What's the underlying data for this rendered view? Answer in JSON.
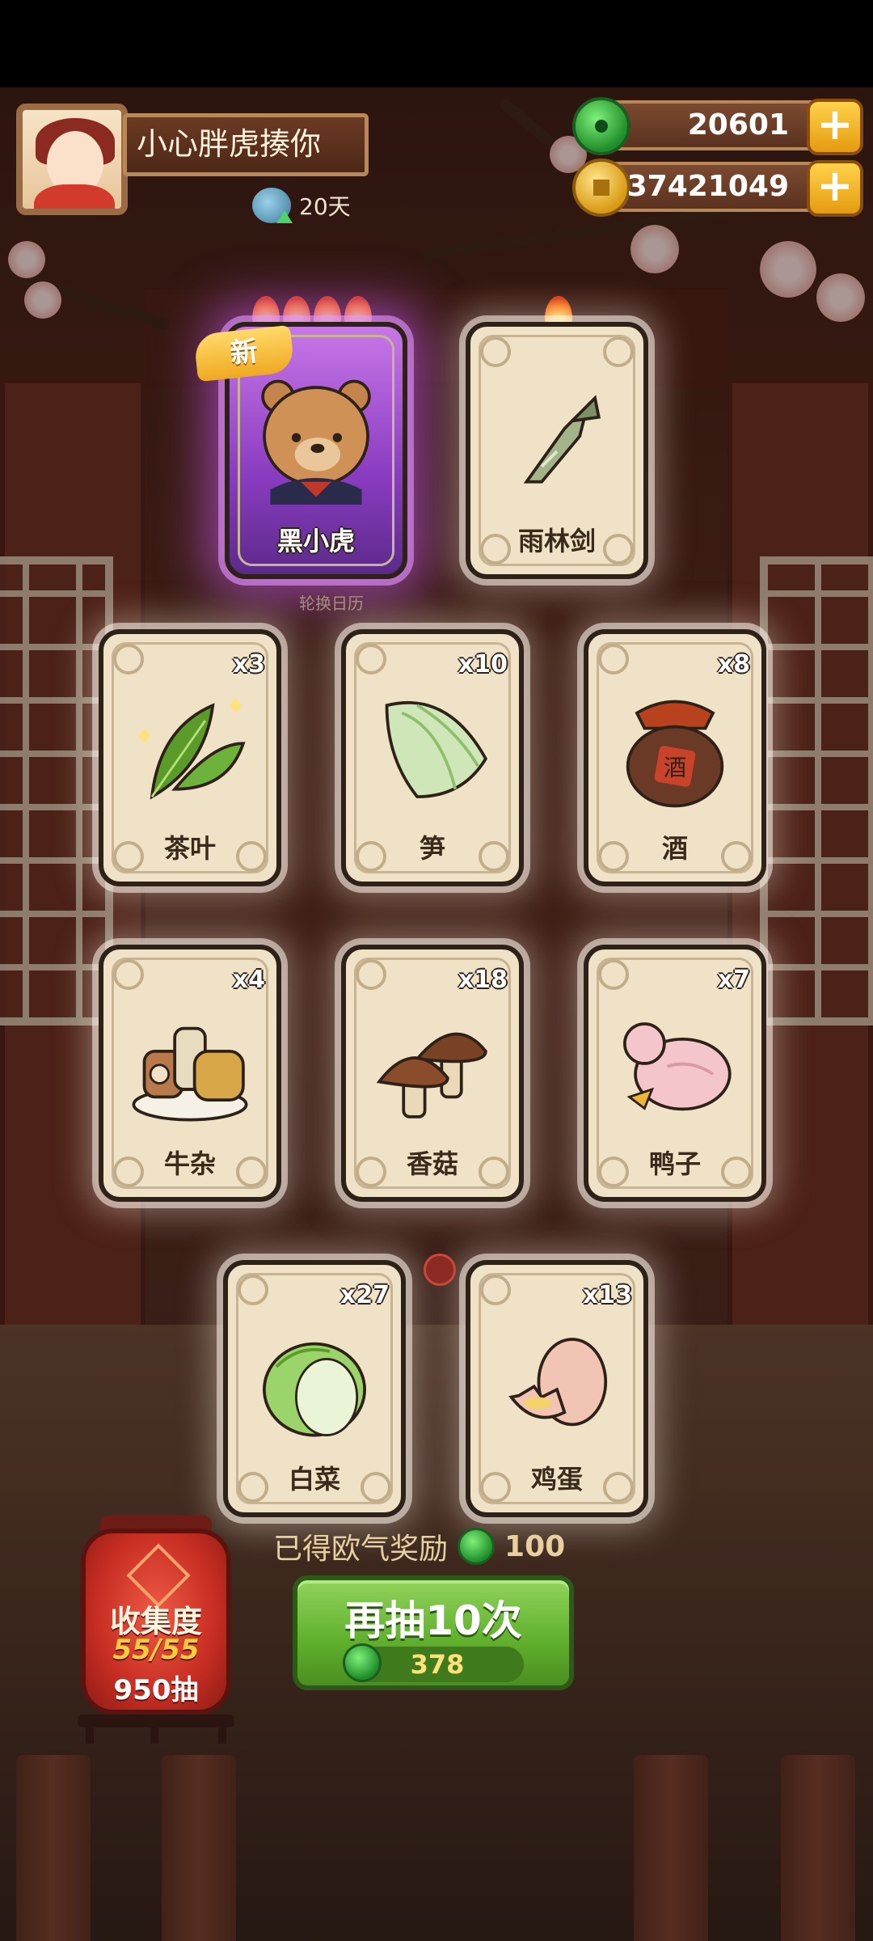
{
  "player": {
    "name": "小心胖虎揍你",
    "days": "20天"
  },
  "currency": {
    "jade": "20601",
    "gold": "37421049",
    "jade_icon": "jade-coin-icon",
    "gold_icon": "gold-coin-icon",
    "plus_label": "+"
  },
  "featured": {
    "badge_new": "新",
    "caption": "轮换日历",
    "cards": [
      {
        "label": "黑小虎",
        "flames": 4,
        "rarity": "purple",
        "icon": "bear-character"
      },
      {
        "label": "雨林剑",
        "flames": 1,
        "rarity": "normal",
        "icon": "jade-dagger"
      }
    ]
  },
  "items": [
    {
      "label": "茶叶",
      "qty": "x3",
      "icon": "tea-leaf"
    },
    {
      "label": "笋",
      "qty": "x10",
      "icon": "bamboo-shoot"
    },
    {
      "label": "酒",
      "qty": "x8",
      "icon": "wine-jar",
      "jar_text": "酒"
    },
    {
      "label": "牛杂",
      "qty": "x4",
      "icon": "beef-offal"
    },
    {
      "label": "香菇",
      "qty": "x18",
      "icon": "shiitake-mushroom"
    },
    {
      "label": "鸭子",
      "qty": "x7",
      "icon": "duck"
    },
    {
      "label": "白菜",
      "qty": "x27",
      "icon": "napa-cabbage"
    },
    {
      "label": "鸡蛋",
      "qty": "x13",
      "icon": "egg"
    }
  ],
  "reward": {
    "text": "已得欧气奖励",
    "amount": "100"
  },
  "draw_button": {
    "label": "再抽10次",
    "cost": "378"
  },
  "collection": {
    "title": "收集度",
    "progress": "55/55",
    "draws": "950抽"
  },
  "colors": {
    "accent_green": "#5fae2c",
    "gold": "#ffcc3a",
    "purple_glow": "#c877e8"
  }
}
